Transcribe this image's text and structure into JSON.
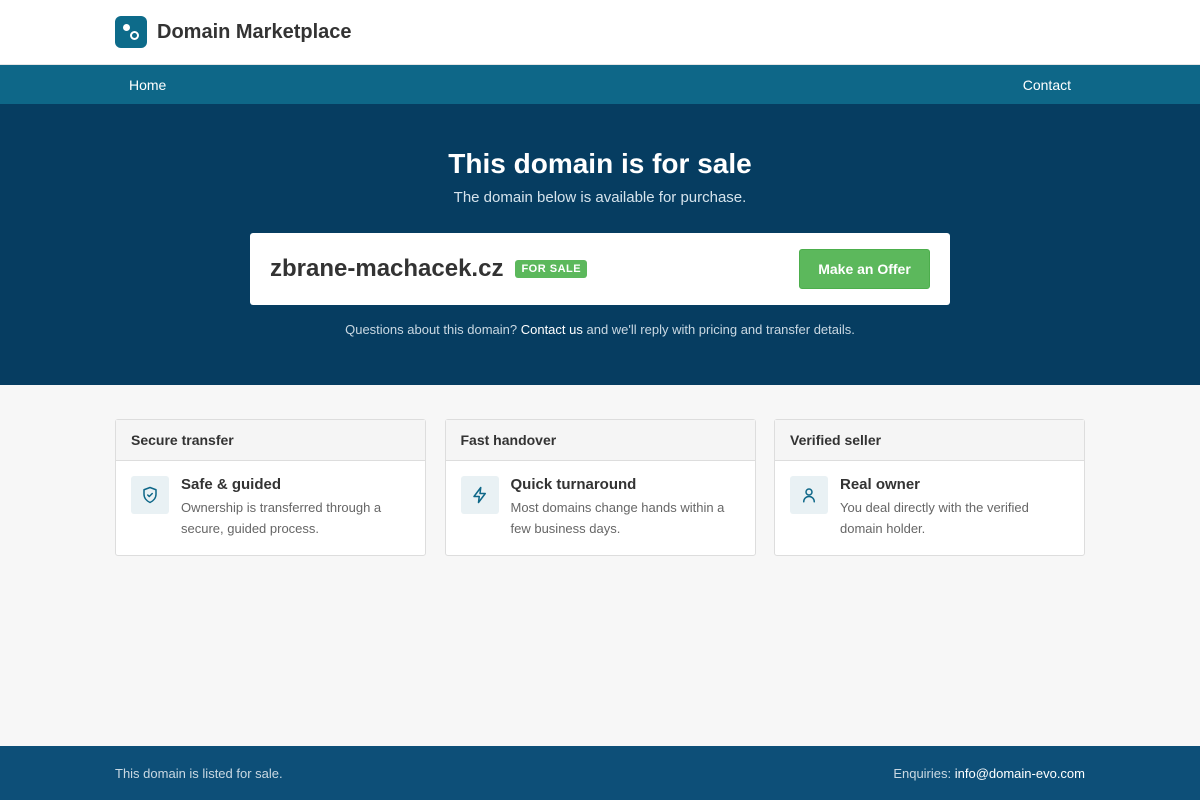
{
  "header": {
    "brand": "Domain Marketplace"
  },
  "nav": {
    "home": "Home",
    "contact": "Contact"
  },
  "hero": {
    "title": "This domain is for sale",
    "subtitle": "The domain below is available for purchase.",
    "domain": "zbrane-machacek.cz",
    "badge": "FOR SALE",
    "offer_button": "Make an Offer",
    "note_before": "Questions about this domain? ",
    "note_link": "Contact us",
    "note_after": " and we'll reply with pricing and transfer details."
  },
  "features": [
    {
      "heading": "Secure transfer",
      "icon": "shield-check-icon",
      "title": "Safe & guided",
      "desc": "Ownership is transferred through a secure, guided process."
    },
    {
      "heading": "Fast handover",
      "icon": "lightning-bolt-icon",
      "title": "Quick turnaround",
      "desc": "Most domains change hands within a few business days."
    },
    {
      "heading": "Verified seller",
      "icon": "user-icon",
      "title": "Real owner",
      "desc": "You deal directly with the verified domain holder."
    }
  ],
  "footer": {
    "left": "This domain is listed for sale.",
    "enquiries_label": "Enquiries: ",
    "email": "info@domain-evo.com"
  },
  "colors": {
    "accent": "#0e6788",
    "hero_bg": "#063d61",
    "success": "#5cb85c",
    "footer_bg": "#0d4f78"
  }
}
